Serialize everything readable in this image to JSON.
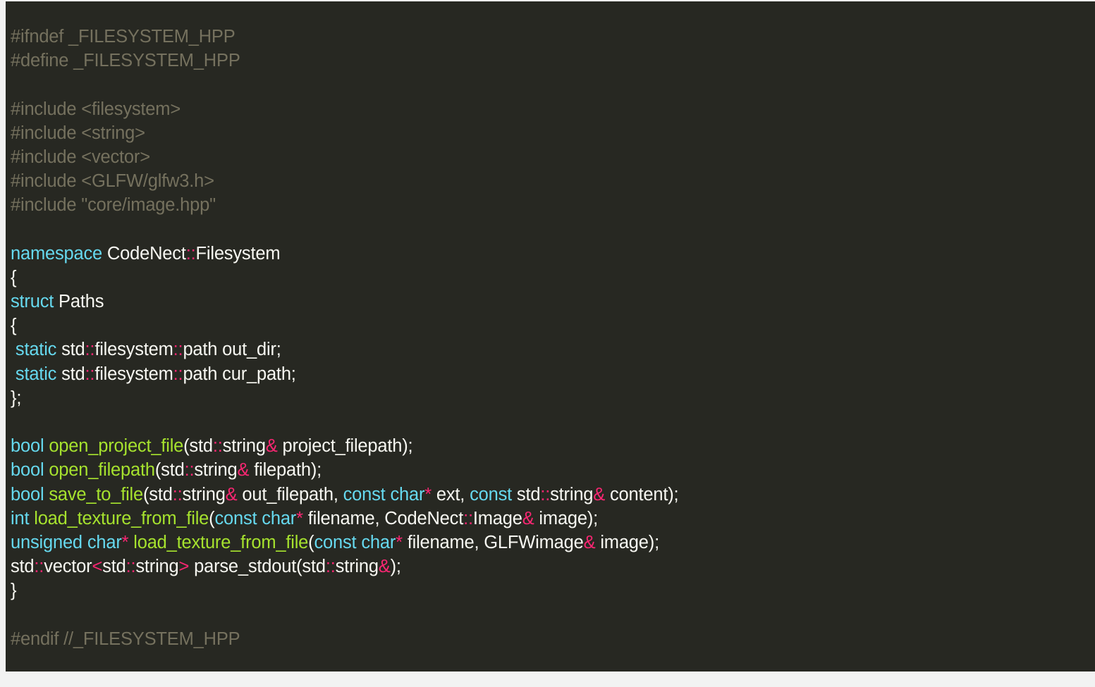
{
  "colors": {
    "background": "#272822",
    "text": "#f8f8f2",
    "comment": "#75715e",
    "keyword": "#66d9ef",
    "function": "#a6e22e",
    "operator": "#f92672"
  },
  "lines": [
    [
      {
        "t": "comment",
        "s": "#ifndef _FILESYSTEM_HPP"
      }
    ],
    [
      {
        "t": "comment",
        "s": "#define _FILESYSTEM_HPP"
      }
    ],
    [],
    [
      {
        "t": "comment",
        "s": "#include <filesystem>"
      }
    ],
    [
      {
        "t": "comment",
        "s": "#include <string>"
      }
    ],
    [
      {
        "t": "comment",
        "s": "#include <vector>"
      }
    ],
    [
      {
        "t": "comment",
        "s": "#include <GLFW/glfw3.h>"
      }
    ],
    [
      {
        "t": "comment",
        "s": "#include \"core/image.hpp\""
      }
    ],
    [],
    [
      {
        "t": "kw",
        "s": "namespace"
      },
      {
        "t": "text",
        "s": " CodeNect"
      },
      {
        "t": "op",
        "s": "::"
      },
      {
        "t": "text",
        "s": "Filesystem"
      }
    ],
    [
      {
        "t": "text",
        "s": "{"
      }
    ],
    [
      {
        "t": "kw",
        "s": "struct"
      },
      {
        "t": "text",
        "s": " Paths"
      }
    ],
    [
      {
        "t": "text",
        "s": "{"
      }
    ],
    [
      {
        "t": "text",
        "s": " "
      },
      {
        "t": "kw",
        "s": "static"
      },
      {
        "t": "text",
        "s": " std"
      },
      {
        "t": "op",
        "s": "::"
      },
      {
        "t": "text",
        "s": "filesystem"
      },
      {
        "t": "op",
        "s": "::"
      },
      {
        "t": "text",
        "s": "path out_dir;"
      }
    ],
    [
      {
        "t": "text",
        "s": " "
      },
      {
        "t": "kw",
        "s": "static"
      },
      {
        "t": "text",
        "s": " std"
      },
      {
        "t": "op",
        "s": "::"
      },
      {
        "t": "text",
        "s": "filesystem"
      },
      {
        "t": "op",
        "s": "::"
      },
      {
        "t": "text",
        "s": "path cur_path;"
      }
    ],
    [
      {
        "t": "text",
        "s": "};"
      }
    ],
    [],
    [
      {
        "t": "kw",
        "s": "bool"
      },
      {
        "t": "text",
        "s": " "
      },
      {
        "t": "fn",
        "s": "open_project_file"
      },
      {
        "t": "text",
        "s": "(std"
      },
      {
        "t": "op",
        "s": "::"
      },
      {
        "t": "text",
        "s": "string"
      },
      {
        "t": "op",
        "s": "&"
      },
      {
        "t": "text",
        "s": " project_filepath);"
      }
    ],
    [
      {
        "t": "kw",
        "s": "bool"
      },
      {
        "t": "text",
        "s": " "
      },
      {
        "t": "fn",
        "s": "open_filepath"
      },
      {
        "t": "text",
        "s": "(std"
      },
      {
        "t": "op",
        "s": "::"
      },
      {
        "t": "text",
        "s": "string"
      },
      {
        "t": "op",
        "s": "&"
      },
      {
        "t": "text",
        "s": " filepath);"
      }
    ],
    [
      {
        "t": "kw",
        "s": "bool"
      },
      {
        "t": "text",
        "s": " "
      },
      {
        "t": "fn",
        "s": "save_to_file"
      },
      {
        "t": "text",
        "s": "(std"
      },
      {
        "t": "op",
        "s": "::"
      },
      {
        "t": "text",
        "s": "string"
      },
      {
        "t": "op",
        "s": "&"
      },
      {
        "t": "text",
        "s": " out_filepath, "
      },
      {
        "t": "kw",
        "s": "const"
      },
      {
        "t": "text",
        "s": " "
      },
      {
        "t": "kw",
        "s": "char"
      },
      {
        "t": "op",
        "s": "*"
      },
      {
        "t": "text",
        "s": " ext, "
      },
      {
        "t": "kw",
        "s": "const"
      },
      {
        "t": "text",
        "s": " std"
      },
      {
        "t": "op",
        "s": "::"
      },
      {
        "t": "text",
        "s": "string"
      },
      {
        "t": "op",
        "s": "&"
      },
      {
        "t": "text",
        "s": " content);"
      }
    ],
    [
      {
        "t": "kw",
        "s": "int"
      },
      {
        "t": "text",
        "s": " "
      },
      {
        "t": "fn",
        "s": "load_texture_from_file"
      },
      {
        "t": "text",
        "s": "("
      },
      {
        "t": "kw",
        "s": "const"
      },
      {
        "t": "text",
        "s": " "
      },
      {
        "t": "kw",
        "s": "char"
      },
      {
        "t": "op",
        "s": "*"
      },
      {
        "t": "text",
        "s": " filename, CodeNect"
      },
      {
        "t": "op",
        "s": "::"
      },
      {
        "t": "text",
        "s": "Image"
      },
      {
        "t": "op",
        "s": "&"
      },
      {
        "t": "text",
        "s": " image);"
      }
    ],
    [
      {
        "t": "kw",
        "s": "unsigned"
      },
      {
        "t": "text",
        "s": " "
      },
      {
        "t": "kw",
        "s": "char"
      },
      {
        "t": "op",
        "s": "*"
      },
      {
        "t": "text",
        "s": " "
      },
      {
        "t": "fn",
        "s": "load_texture_from_file"
      },
      {
        "t": "text",
        "s": "("
      },
      {
        "t": "kw",
        "s": "const"
      },
      {
        "t": "text",
        "s": " "
      },
      {
        "t": "kw",
        "s": "char"
      },
      {
        "t": "op",
        "s": "*"
      },
      {
        "t": "text",
        "s": " filename, GLFWimage"
      },
      {
        "t": "op",
        "s": "&"
      },
      {
        "t": "text",
        "s": " image);"
      }
    ],
    [
      {
        "t": "text",
        "s": "std"
      },
      {
        "t": "op",
        "s": "::"
      },
      {
        "t": "text",
        "s": "vector"
      },
      {
        "t": "op",
        "s": "<"
      },
      {
        "t": "text",
        "s": "std"
      },
      {
        "t": "op",
        "s": "::"
      },
      {
        "t": "text",
        "s": "string"
      },
      {
        "t": "op",
        "s": ">"
      },
      {
        "t": "text",
        "s": " parse_stdout(std"
      },
      {
        "t": "op",
        "s": "::"
      },
      {
        "t": "text",
        "s": "string"
      },
      {
        "t": "op",
        "s": "&"
      },
      {
        "t": "text",
        "s": ");"
      }
    ],
    [
      {
        "t": "text",
        "s": "}"
      }
    ],
    [],
    [
      {
        "t": "comment",
        "s": "#endif //_FILESYSTEM_HPP"
      }
    ]
  ]
}
